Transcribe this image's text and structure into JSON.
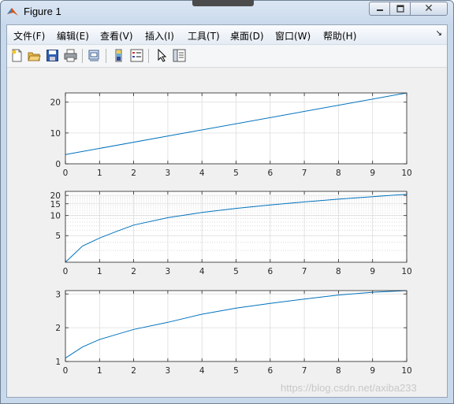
{
  "window": {
    "title": "Figure 1",
    "icon": "matlab-logo-icon",
    "controls": {
      "minimize": "minimize-icon",
      "maximize": "maximize-icon",
      "close": "✕"
    }
  },
  "menu": {
    "items": [
      "文件(F)",
      "编辑(E)",
      "查看(V)",
      "插入(I)",
      "工具(T)",
      "桌面(D)",
      "窗口(W)",
      "帮助(H)"
    ],
    "dock_icon": "↘"
  },
  "toolbar": {
    "icons": [
      "new-figure-icon",
      "open-file-icon",
      "save-icon",
      "print-icon",
      "link-plot-icon",
      "colorbar-icon",
      "legend-icon",
      "pointer-icon",
      "property-inspector-icon"
    ]
  },
  "colors": {
    "line": "#0072bd",
    "grid": "#dcdcdc",
    "axes_bg": "#ffffff"
  },
  "chart_data": [
    {
      "type": "line",
      "x_range": [
        0,
        10
      ],
      "y_range": [
        0,
        23
      ],
      "xticks": [
        "0",
        "1",
        "2",
        "3",
        "4",
        "5",
        "6",
        "7",
        "8",
        "9",
        "10"
      ],
      "yticks": [
        "0",
        "10",
        "20"
      ],
      "grid": "on",
      "series": [
        {
          "x": [
            0,
            10
          ],
          "y": [
            3,
            23
          ]
        }
      ]
    },
    {
      "type": "line",
      "y_scale": "log",
      "x_range": [
        0,
        10
      ],
      "y_range": [
        2,
        23
      ],
      "xticks": [
        "0",
        "1",
        "2",
        "3",
        "4",
        "5",
        "6",
        "7",
        "8",
        "9",
        "10"
      ],
      "yticks": [
        "5",
        "10",
        "15",
        "20"
      ],
      "grid": "on (with minor log grid)",
      "series": [
        {
          "x": [
            0,
            0.5,
            1,
            1.5,
            2,
            3,
            4,
            5,
            6,
            7,
            8,
            9,
            10
          ],
          "y": [
            2,
            3.5,
            4.6,
            5.8,
            7.2,
            9.3,
            11.1,
            12.8,
            14.4,
            16,
            17.6,
            19.2,
            20.8
          ]
        }
      ]
    },
    {
      "type": "line",
      "x_range": [
        0,
        10
      ],
      "y_range": [
        1,
        3.1
      ],
      "xticks": [
        "0",
        "1",
        "2",
        "3",
        "4",
        "5",
        "6",
        "7",
        "8",
        "9",
        "10"
      ],
      "yticks": [
        "1",
        "2",
        "3"
      ],
      "grid": "on",
      "series": [
        {
          "x": [
            0,
            0.5,
            1,
            1.5,
            2,
            3,
            4,
            5,
            6,
            7,
            8,
            9,
            10
          ],
          "y": [
            1.1,
            1.43,
            1.65,
            1.8,
            1.95,
            2.16,
            2.4,
            2.58,
            2.72,
            2.85,
            2.97,
            3.05,
            3.1
          ]
        }
      ]
    }
  ],
  "watermark": "https://blog.csdn.net/axiba233"
}
